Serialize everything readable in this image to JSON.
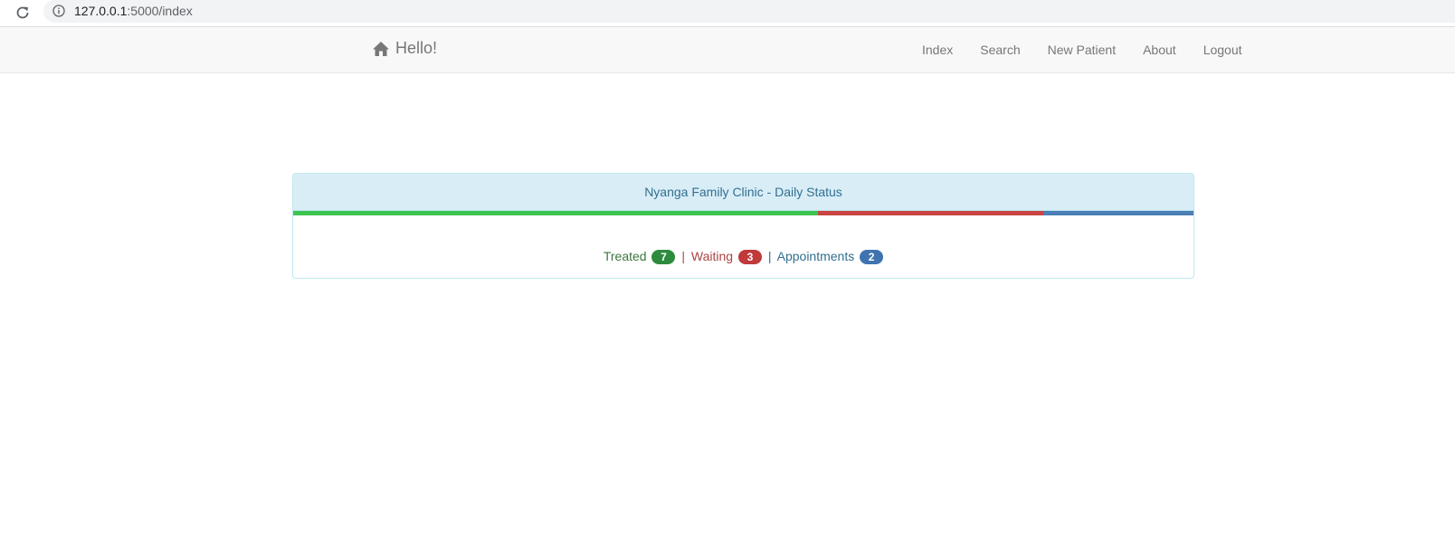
{
  "browser": {
    "url_host": "127.0.0.1",
    "url_rest": ":5000/index"
  },
  "navbar": {
    "brand_label": "Hello!",
    "brand_icon": "home-icon",
    "links": [
      "Index",
      "Search",
      "New Patient",
      "About",
      "Logout"
    ]
  },
  "panel": {
    "title": "Nyanga Family Clinic - Daily Status",
    "progress": [
      {
        "name": "treated",
        "fraction": 0.583,
        "color": "#3dc451"
      },
      {
        "name": "waiting",
        "fraction": 0.25,
        "color": "#c94442"
      },
      {
        "name": "appointments",
        "fraction": 0.167,
        "color": "#4b7fb5"
      }
    ],
    "stats": {
      "treated_label": "Treated",
      "treated_count": "7",
      "waiting_label": "Waiting",
      "waiting_count": "3",
      "appointments_label": "Appointments",
      "appointments_count": "2",
      "separator": "|"
    }
  },
  "colors": {
    "treated_badge": "#2e8b3d",
    "waiting_badge": "#c0393b",
    "appointments_badge": "#3f74b0"
  }
}
